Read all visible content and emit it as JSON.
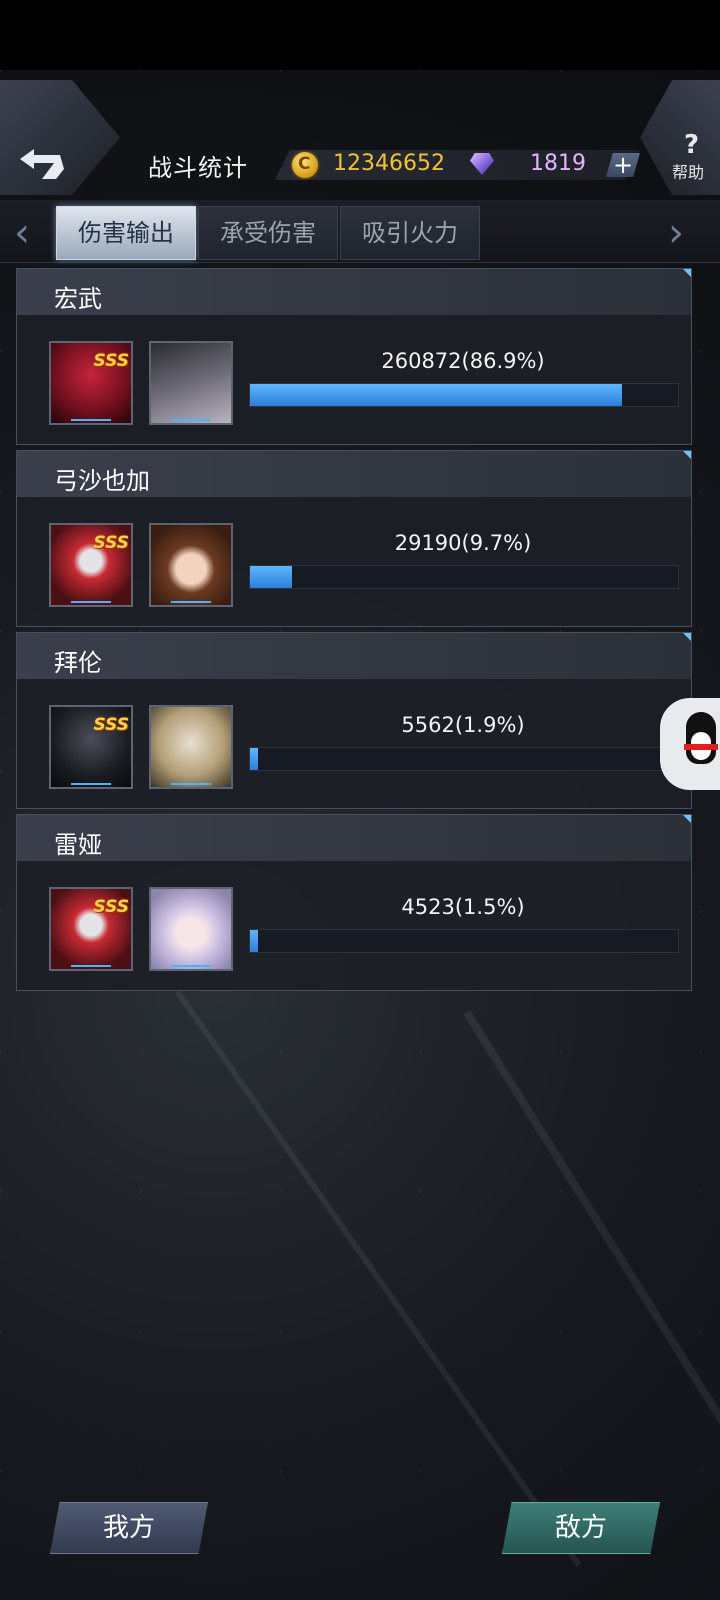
{
  "header": {
    "title": "战斗统计",
    "gold": "12346652",
    "gems": "1819",
    "help_label": "帮助"
  },
  "tabs": [
    {
      "label": "伤害输出",
      "active": true
    },
    {
      "label": "承受伤害",
      "active": false
    },
    {
      "label": "吸引火力",
      "active": false
    }
  ],
  "entries": [
    {
      "name": "宏武",
      "value_text": "260872(86.9%)",
      "percent": 86.9,
      "rank": "SSS"
    },
    {
      "name": "弓沙也加",
      "value_text": "29190(9.7%)",
      "percent": 9.7,
      "rank": "SSS"
    },
    {
      "name": "拜伦",
      "value_text": "5562(1.9%)",
      "percent": 1.9,
      "rank": "SSS"
    },
    {
      "name": "雷娅",
      "value_text": "4523(1.5%)",
      "percent": 1.5,
      "rank": "SSS"
    }
  ],
  "bottom": {
    "ours_label": "我方",
    "enemy_label": "敌方"
  },
  "colors": {
    "bar": "#2d7ed8",
    "gold": "#f3c234",
    "gem": "#e7b5ff"
  }
}
